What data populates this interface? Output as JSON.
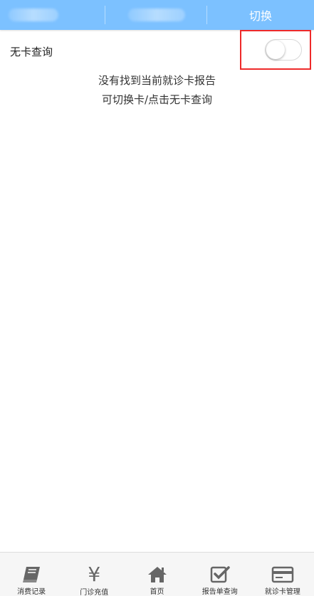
{
  "header": {
    "switch_label": "切换"
  },
  "nocard": {
    "label": "无卡查询",
    "toggle_on": false
  },
  "message": {
    "line1": "没有找到当前就诊卡报告",
    "line2": "可切换卡/点击无卡查询"
  },
  "nav": {
    "items": [
      {
        "label": "消费记录",
        "icon": "book-icon"
      },
      {
        "label": "门诊充值",
        "icon": "yen-icon"
      },
      {
        "label": "首页",
        "icon": "home-icon"
      },
      {
        "label": "报告单查询",
        "icon": "checkbox-icon"
      },
      {
        "label": "就诊卡管理",
        "icon": "card-icon"
      }
    ]
  },
  "colors": {
    "header_bg": "#7cc1ff",
    "highlight": "#ee2a2a",
    "icon_gray": "#666666"
  }
}
